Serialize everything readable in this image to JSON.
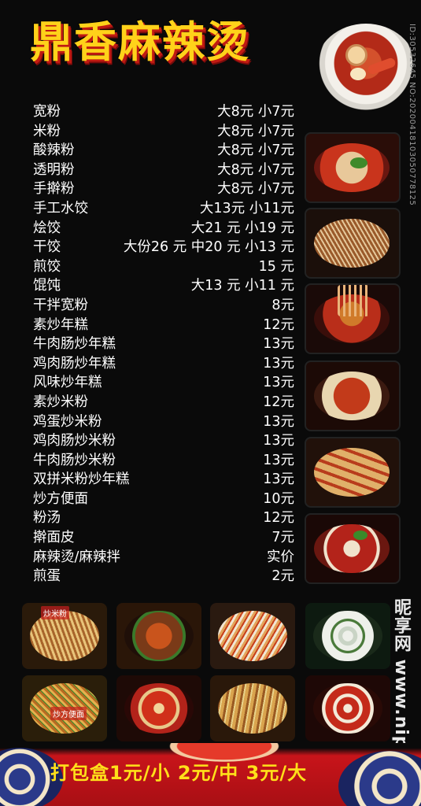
{
  "title": "鼎香麻辣烫",
  "watermark_id": "ID:30532645 NO:20200418103050778125",
  "watermark_site": "昵享网 www.nipic.cn",
  "menu": [
    {
      "name": "宽粉",
      "price": "大8元  小7元"
    },
    {
      "name": "米粉",
      "price": "大8元  小7元"
    },
    {
      "name": "酸辣粉",
      "price": "大8元  小7元"
    },
    {
      "name": "透明粉",
      "price": "大8元  小7元"
    },
    {
      "name": "手擀粉",
      "price": "大8元  小7元"
    },
    {
      "name": "手工水饺",
      "price": "大13元 小11元"
    },
    {
      "name": "烩饺",
      "price": "大21 元 小19 元"
    },
    {
      "name": "干饺",
      "price": "大份26 元 中20 元 小13 元"
    },
    {
      "name": "煎饺",
      "price": "15 元"
    },
    {
      "name": "馄饨",
      "price": "大13 元 小11 元"
    },
    {
      "name": "干拌宽粉",
      "price": "8元"
    },
    {
      "name": "素炒年糕",
      "price": "12元"
    },
    {
      "name": "牛肉肠炒年糕",
      "price": "13元"
    },
    {
      "name": "鸡肉肠炒年糕",
      "price": "13元"
    },
    {
      "name": "风味炒年糕",
      "price": "13元"
    },
    {
      "name": "素炒米粉",
      "price": "12元"
    },
    {
      "name": "鸡蛋炒米粉",
      "price": "13元"
    },
    {
      "name": "鸡肉肠炒米粉",
      "price": "13元"
    },
    {
      "name": "牛肉肠炒米粉",
      "price": "13元"
    },
    {
      "name": "双拼米粉炒年糕",
      "price": "13元"
    },
    {
      "name": "炒方便面",
      "price": "10元"
    },
    {
      "name": "粉汤",
      "price": "12元"
    },
    {
      "name": "擀面皮",
      "price": "7元"
    },
    {
      "name": "麻辣烫/麻辣拌",
      "price": "实价"
    },
    {
      "name": "煎蛋",
      "price": "2元"
    }
  ],
  "grid_labels": {
    "fried_rice_noodles": "炒米粉",
    "fried_instant_noodles": "炒方便面"
  },
  "footer": "打包盒1元/小  2元/中  3元/大",
  "colors": {
    "title": "#ffd21a",
    "title_shadow": "#c01a12",
    "text": "#ffffff",
    "footer_text": "#ffe01a",
    "footer_bg": "#c8141a"
  }
}
